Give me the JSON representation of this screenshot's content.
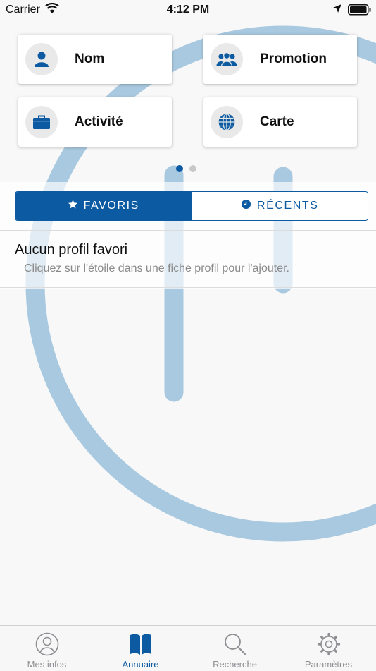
{
  "status_bar": {
    "carrier": "Carrier",
    "time": "4:12 PM"
  },
  "shortcuts": [
    {
      "label": "Nom",
      "icon": "person-icon"
    },
    {
      "label": "Promotion",
      "icon": "group-icon"
    },
    {
      "label": "Activité",
      "icon": "briefcase-icon"
    },
    {
      "label": "Carte",
      "icon": "globe-icon"
    }
  ],
  "pager": {
    "pages": 2,
    "current": 1
  },
  "segmented": {
    "favorites_label": "FAVORIS",
    "recents_label": "RÉCENTS",
    "selected": "favorites"
  },
  "empty_state": {
    "title": "Aucun profil favori",
    "hint": "Cliquez sur l'étoile dans une fiche profil pour l'ajouter."
  },
  "tabbar": {
    "items": [
      {
        "label": "Mes infos",
        "icon": "user-circle-icon"
      },
      {
        "label": "Annuaire",
        "icon": "book-icon",
        "active": true
      },
      {
        "label": "Recherche",
        "icon": "search-icon"
      },
      {
        "label": "Paramètres",
        "icon": "gear-icon"
      }
    ]
  },
  "colors": {
    "accent": "#0b5aa2",
    "background_logo": "#a9c9e0",
    "tab_inactive": "#8e8e93"
  }
}
